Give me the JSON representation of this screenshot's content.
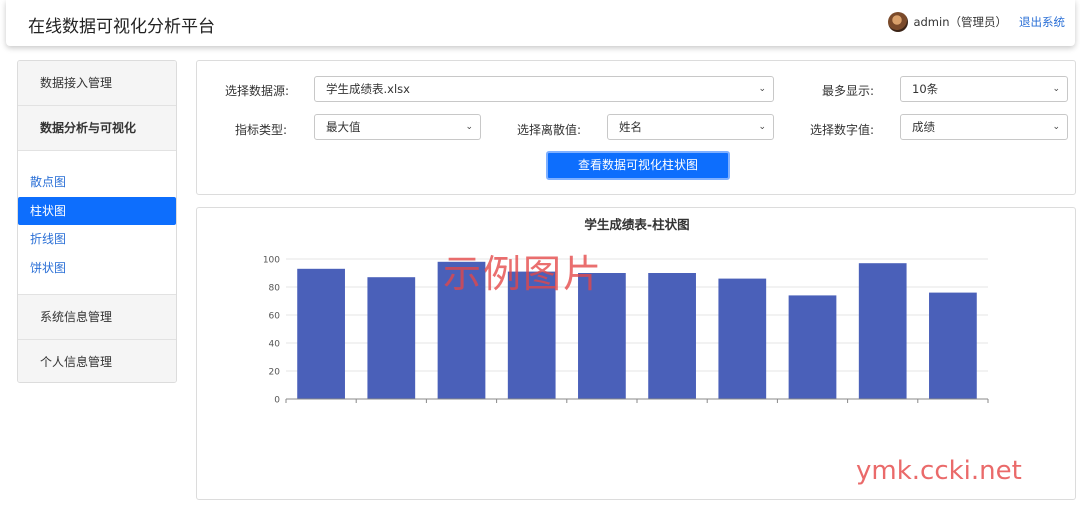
{
  "header": {
    "app_title": "在线数据可视化分析平台",
    "username": "admin（管理员）",
    "logout": "退出系统"
  },
  "sidebar": {
    "group_data_access": "数据接入管理",
    "group_analysis": "数据分析与可视化",
    "items": [
      {
        "label": "散点图",
        "active": false
      },
      {
        "label": "柱状图",
        "active": true
      },
      {
        "label": "折线图",
        "active": false
      },
      {
        "label": "饼状图",
        "active": false
      }
    ],
    "group_system_info": "系统信息管理",
    "group_personal_info": "个人信息管理"
  },
  "controls": {
    "datasource_label": "选择数据源:",
    "datasource_value": "学生成绩表.xlsx",
    "max_show_label": "最多显示:",
    "max_show_value": "10条",
    "metric_type_label": "指标类型:",
    "metric_type_value": "最大值",
    "discrete_label": "选择离散值:",
    "discrete_value": "姓名",
    "numeric_label": "选择数字值:",
    "numeric_value": "成绩",
    "view_button": "查看数据可视化柱状图"
  },
  "chart_data": {
    "type": "bar",
    "title": "学生成绩表-柱状图",
    "categories": [
      "",
      "",
      "",
      "",
      "",
      "",
      "",
      "",
      "",
      ""
    ],
    "values": [
      93,
      87,
      98,
      91,
      90,
      90,
      86,
      74,
      97,
      76
    ],
    "yticks": [
      0,
      20,
      40,
      60,
      80,
      100
    ],
    "ylim": [
      0,
      100
    ],
    "bar_color": "#4a60b9",
    "grid": true
  },
  "watermarks": {
    "cn": "示例图片",
    "url": "ymk.ccki.net"
  },
  "colors": {
    "accent": "#0d6efd",
    "link": "#2a6fd6"
  }
}
